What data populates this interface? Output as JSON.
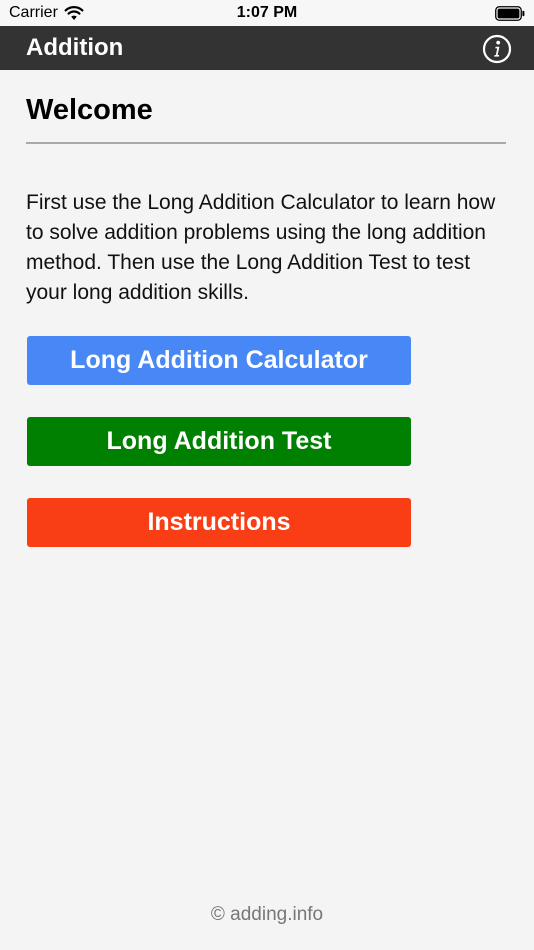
{
  "status_bar": {
    "carrier": "Carrier",
    "time": "1:07 PM",
    "wifi_icon": "wifi-icon",
    "battery_icon": "battery-icon"
  },
  "nav": {
    "title": "Addition",
    "info_icon": "info-icon",
    "background": "#333333"
  },
  "main": {
    "heading": "Welcome",
    "intro": "First use the Long Addition Calculator to learn how to solve addition problems using the long addition method. Then use the Long Addition Test to test your long addition skills."
  },
  "buttons": [
    {
      "label": "Long Addition Calculator",
      "color": "#4887f6"
    },
    {
      "label": "Long Addition Test",
      "color": "#008000"
    },
    {
      "label": "Instructions",
      "color": "#f93e16"
    }
  ],
  "footer": {
    "text": "© adding.info"
  }
}
